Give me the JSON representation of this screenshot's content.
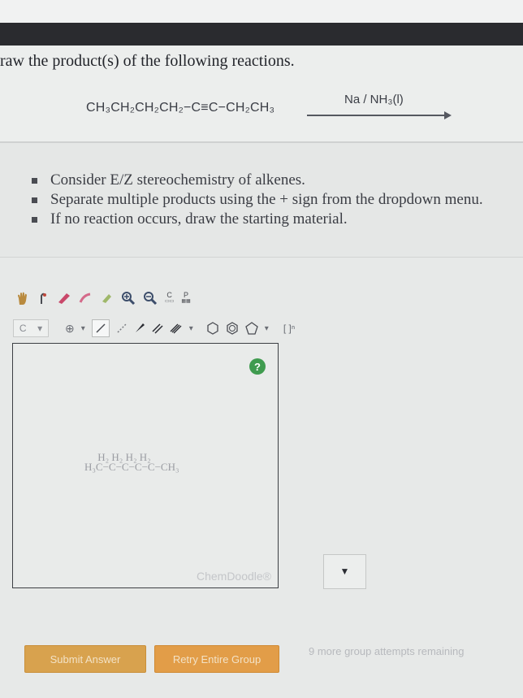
{
  "question": {
    "prompt": "raw the product(s) of the following reactions.",
    "reactant": "CH₃CH₂CH₂CH₂−C≡C−CH₂CH₃",
    "reagent": "Na / NH₃(l)"
  },
  "instructions": [
    "Consider E/Z stereochemistry of alkenes.",
    "Separate multiple products using the + sign from the dropdown menu.",
    "If no reaction occurs, draw the starting material."
  ],
  "toolbar": {
    "element_selected": "C",
    "row1_icons": [
      "hand-icon",
      "lasso-icon",
      "eraser-icon",
      "pencil-icon",
      "paint-icon",
      "zoom-in-icon",
      "zoom-out-icon",
      "carbon-label-icon",
      "periodic-table-icon"
    ],
    "carbon_label": "C",
    "periodic_label": "P"
  },
  "canvas": {
    "help_label": "?",
    "structure_top": "     H₂ H₂ H₂ H₂",
    "structure_bottom": "H₃C−C−C−C−C−CH₃",
    "watermark": "ChemDoodle®"
  },
  "buttons": {
    "submit": "Submit Answer",
    "retry": "Retry Entire Group",
    "attempts": "9 more group attempts remaining"
  },
  "colors": {
    "submit": "#d8a24e",
    "retry": "#e29d48",
    "help": "#3f9b4f"
  }
}
